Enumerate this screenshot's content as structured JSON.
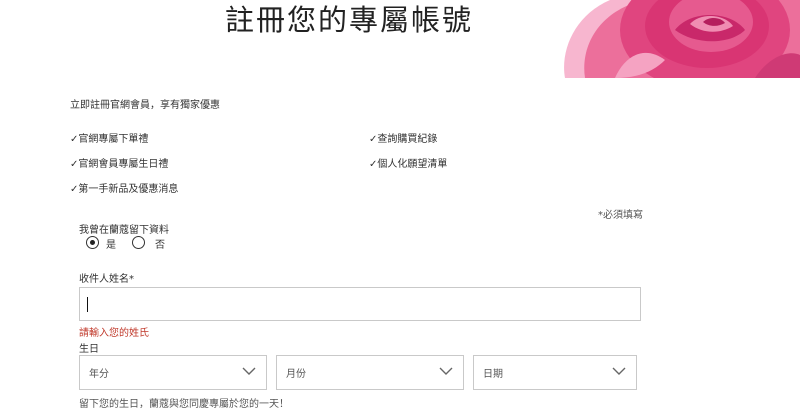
{
  "page_title": "註冊您的專屬帳號",
  "intro": "立即註冊官網會員，享有獨家優惠",
  "benefits": [
    "✓官網專屬下單禮",
    "✓查詢購買紀錄",
    "✓官網會員專屬生日禮",
    "✓個人化願望清單",
    "✓第一手新品及優惠消息"
  ],
  "required_note": "*必須填寫",
  "prior_question": {
    "label": "我曾在蘭蔻留下資料",
    "options": [
      "是",
      "否"
    ],
    "selected": "是"
  },
  "name_field": {
    "label": "收件人姓名*",
    "value": "",
    "error": "請輸入您的姓氏"
  },
  "birthday": {
    "label": "生日",
    "year_placeholder": "年分",
    "month_placeholder": "月份",
    "day_placeholder": "日期",
    "helper": "留下您的生日，蘭蔻與您同慶專屬於您的一天！"
  },
  "colors": {
    "error": "#c0392b",
    "rose_primary": "#e0457f",
    "border": "#c9c9c9"
  },
  "icons": {
    "dropdown": "chevron-down-icon",
    "hero": "rose-image"
  }
}
